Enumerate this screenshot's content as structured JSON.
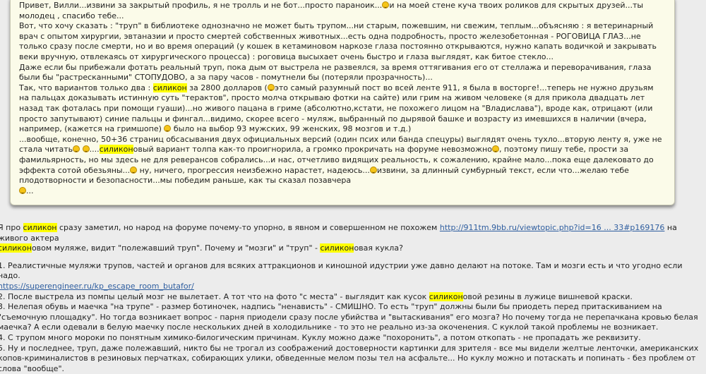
{
  "quote": {
    "p1": "Привет, Вилли...извини за закрытый профиль, я не тролль и не бот...просто параноик...",
    "p1b": "и на моей стене куча твоих роликов для скрытых друзей...ты молодец , спасибо тебе...",
    "p2": "Вот, что хочу сказать : \"труп\" в библиотеке однозначно не может быть трупом...ни старым, пожевшим, ни свежим, теплым...объясняю : я ветеринарный врач с опытом хирургии, эвтаназии и просто смертей собственных животных...есть одна подробность, просто железобетонная - РОГОВИЦА ГЛАЗ...не только сразу после смерти, но и во время операций (у кошек в кетаминовом наркозе глаза постоянно открываются, нужно капать водичкой и закрывать веки вручную, отвлекаясь от хирургического процесса) : роговица высыхает очень быстро и глаза выглядят, как битое стекло...",
    "p3": "Даже если бы прибежали фотать реальный труп, пока дым от выстрела не развеялся, за время оттягивания его от стеллажа и переворачивания, глаза были бы \"растресканными\" СТОПУДОВО, а за пару часов - помутнели бы (потеряли прозрачность)...",
    "p4a": "Так, что вариантов только два : ",
    "p4hl": "силикон",
    "p4b": " за 2800 долларов (",
    "p4c": "это самый разумный пост во всей ленте 911, я была в восторге!...теперь не нужно друзьям на пальцах доказывать истинную суть \"терактов\", просто молча открываю фотки на сайте) или грим на живом человеке (я для прикола двадцать лет назад так фоталась при помощи гуаши)...но живого пацана в гриме (абсолютно,кстати, не похожего лицом на \"Владислава\"), вроде как, отрицают (или просто запутывают) синие пальцы и фингал...видимо, скорее всего - муляж, выбранный по дырявой башке и возрасту из имевшихся в наличии (вчера, например, (кажется на гримшопе) ",
    "p4d": " было на выбор 93 мужских, 99 женских, 98 мозгов и т.д.)",
    "p5a": "...вообще, конечно, 50+36 страниц обсасывания двух официальных версий (один псих или банда спецуры) выглядят очень тухло...вторую ленту я, уже не стала читать",
    "p5b": "....",
    "p5hl": "силикон",
    "p5c": "овый вариант толпа как-то проигнорила, а громко прокричать на форуме невозможно",
    "p5d": ", поэтому пишу тебе, прости за фамильярность, но мы здесь не для реверансов собрались...и нас, отчетливо видящих реальность, к сожалению, крайне мало...пока еще далековато до эффекта сотой обезьяны...",
    "p5e": "ну, ничего, прогрессия неизбежно нарастет, надеюсь...",
    "p5f": "извини, за длинный сумбурный текст, если что...желаю тебе плодотворности и безопасности...мы победим раньше, как ты сказал позавчера",
    "p5g": "..."
  },
  "post": {
    "l1a": "Я про ",
    "l1hl": "силикон",
    "l1b": " сразу заметил, но народ на форуме почему-то упорно, в явном и совершенном не похожем ",
    "l1link": "http://911tm.9bb.ru/viewtopic.php?id=16 ... 33#p169176",
    "l1c": "  на живого актера ",
    "l2hl": "силикон",
    "l2a": "овом муляже, видит  \"полежавший труп\". Почему и \"мозги\" и \"труп\" - ",
    "l2hl2": "силикон",
    "l2b": "овая кукла?",
    "i1": "1. Реалистичные муляжи трупов, частей и органов для всяких  аттракционов и киношной идустрии уже давно делают на потоке. Там и мозги есть и что угодно если надо.",
    "i1link": "https://superengineer.ru/kp_escape_room_butafor/",
    "i2a": "2. После выстрела из помпы целый мозг не вылетает. А тот что на фото \"с места\" - выглядит как кусок ",
    "i2hl": "силикон",
    "i2b": "овой резины в лужице вишневой краски.",
    "i3": "3. Нелепая обувь и маечка \"на трупе\" - размер ботиночек, надпись \"ненависть\" - СМИШНО. То есть \"труп\" должны были бы приодеть перед притаскиванием на \"съемочную площадку\". Но тогда возникает вопрос - парня приодели сразу после убийства и \"вытаскивания\" его мозга? Но почему тогда не перепачкана кровью белая маечка? А если одевали в белую маечку после нескольких дней в холодильнике - то это не реально из-за окоченения. С куклой такой проблемы не возникает.",
    "i4": "4. С трупом много мороки по понятным химико-билогическим причинам. Куклу можно даже \"похоронить\", а потом откопать - не пропадать же реквизиту.",
    "i5": "5. Ну и последнее, труп, даже полежавший, никто бы не трогал из соображений достоверности картинки для зрителя - все мы видели желтые ленточки, американских копов-криминалистов в резиновых перчатках, собирающих улики, обведенные мелом позы тел на асфальте...  Но куклу можно и потаскать и попинать - без проблем от слова \"вообще\"."
  }
}
